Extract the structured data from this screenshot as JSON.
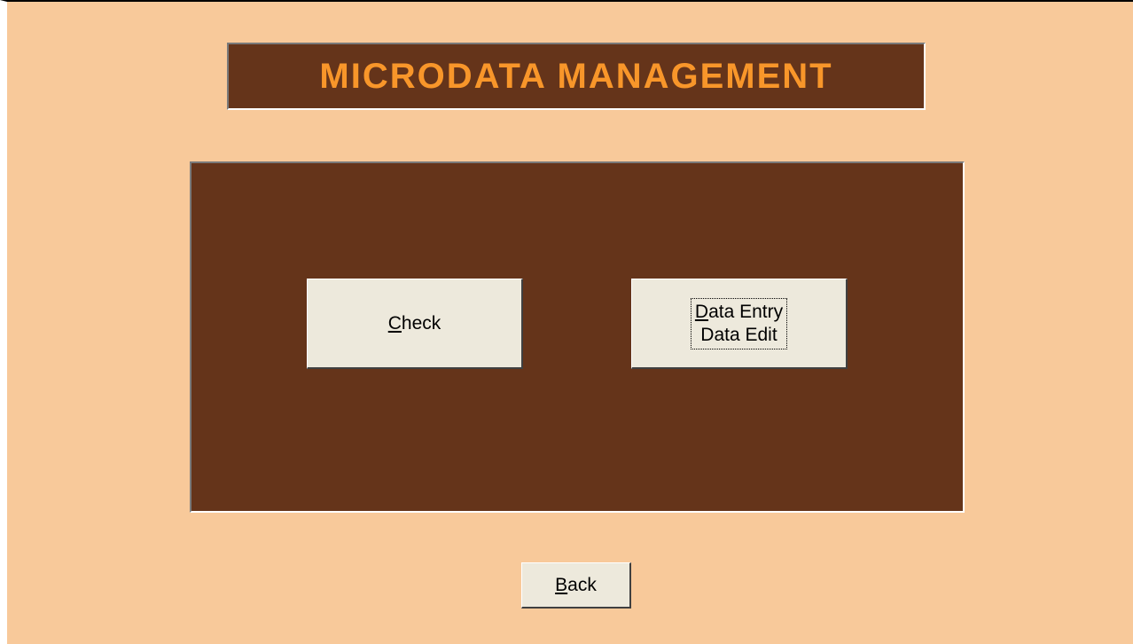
{
  "header": {
    "title": "MICRODATA MANAGEMENT"
  },
  "buttons": {
    "check": {
      "mnemonic": "C",
      "rest": "heck"
    },
    "data_entry": {
      "line1_mnemonic": "D",
      "line1_rest": "ata Entry",
      "line2": "Data Edit"
    },
    "back": {
      "mnemonic": "B",
      "rest": "ack"
    }
  },
  "colors": {
    "background": "#f8c99a",
    "panel": "#65341a",
    "title_text": "#f8962a",
    "button_face": "#ede9dc"
  }
}
